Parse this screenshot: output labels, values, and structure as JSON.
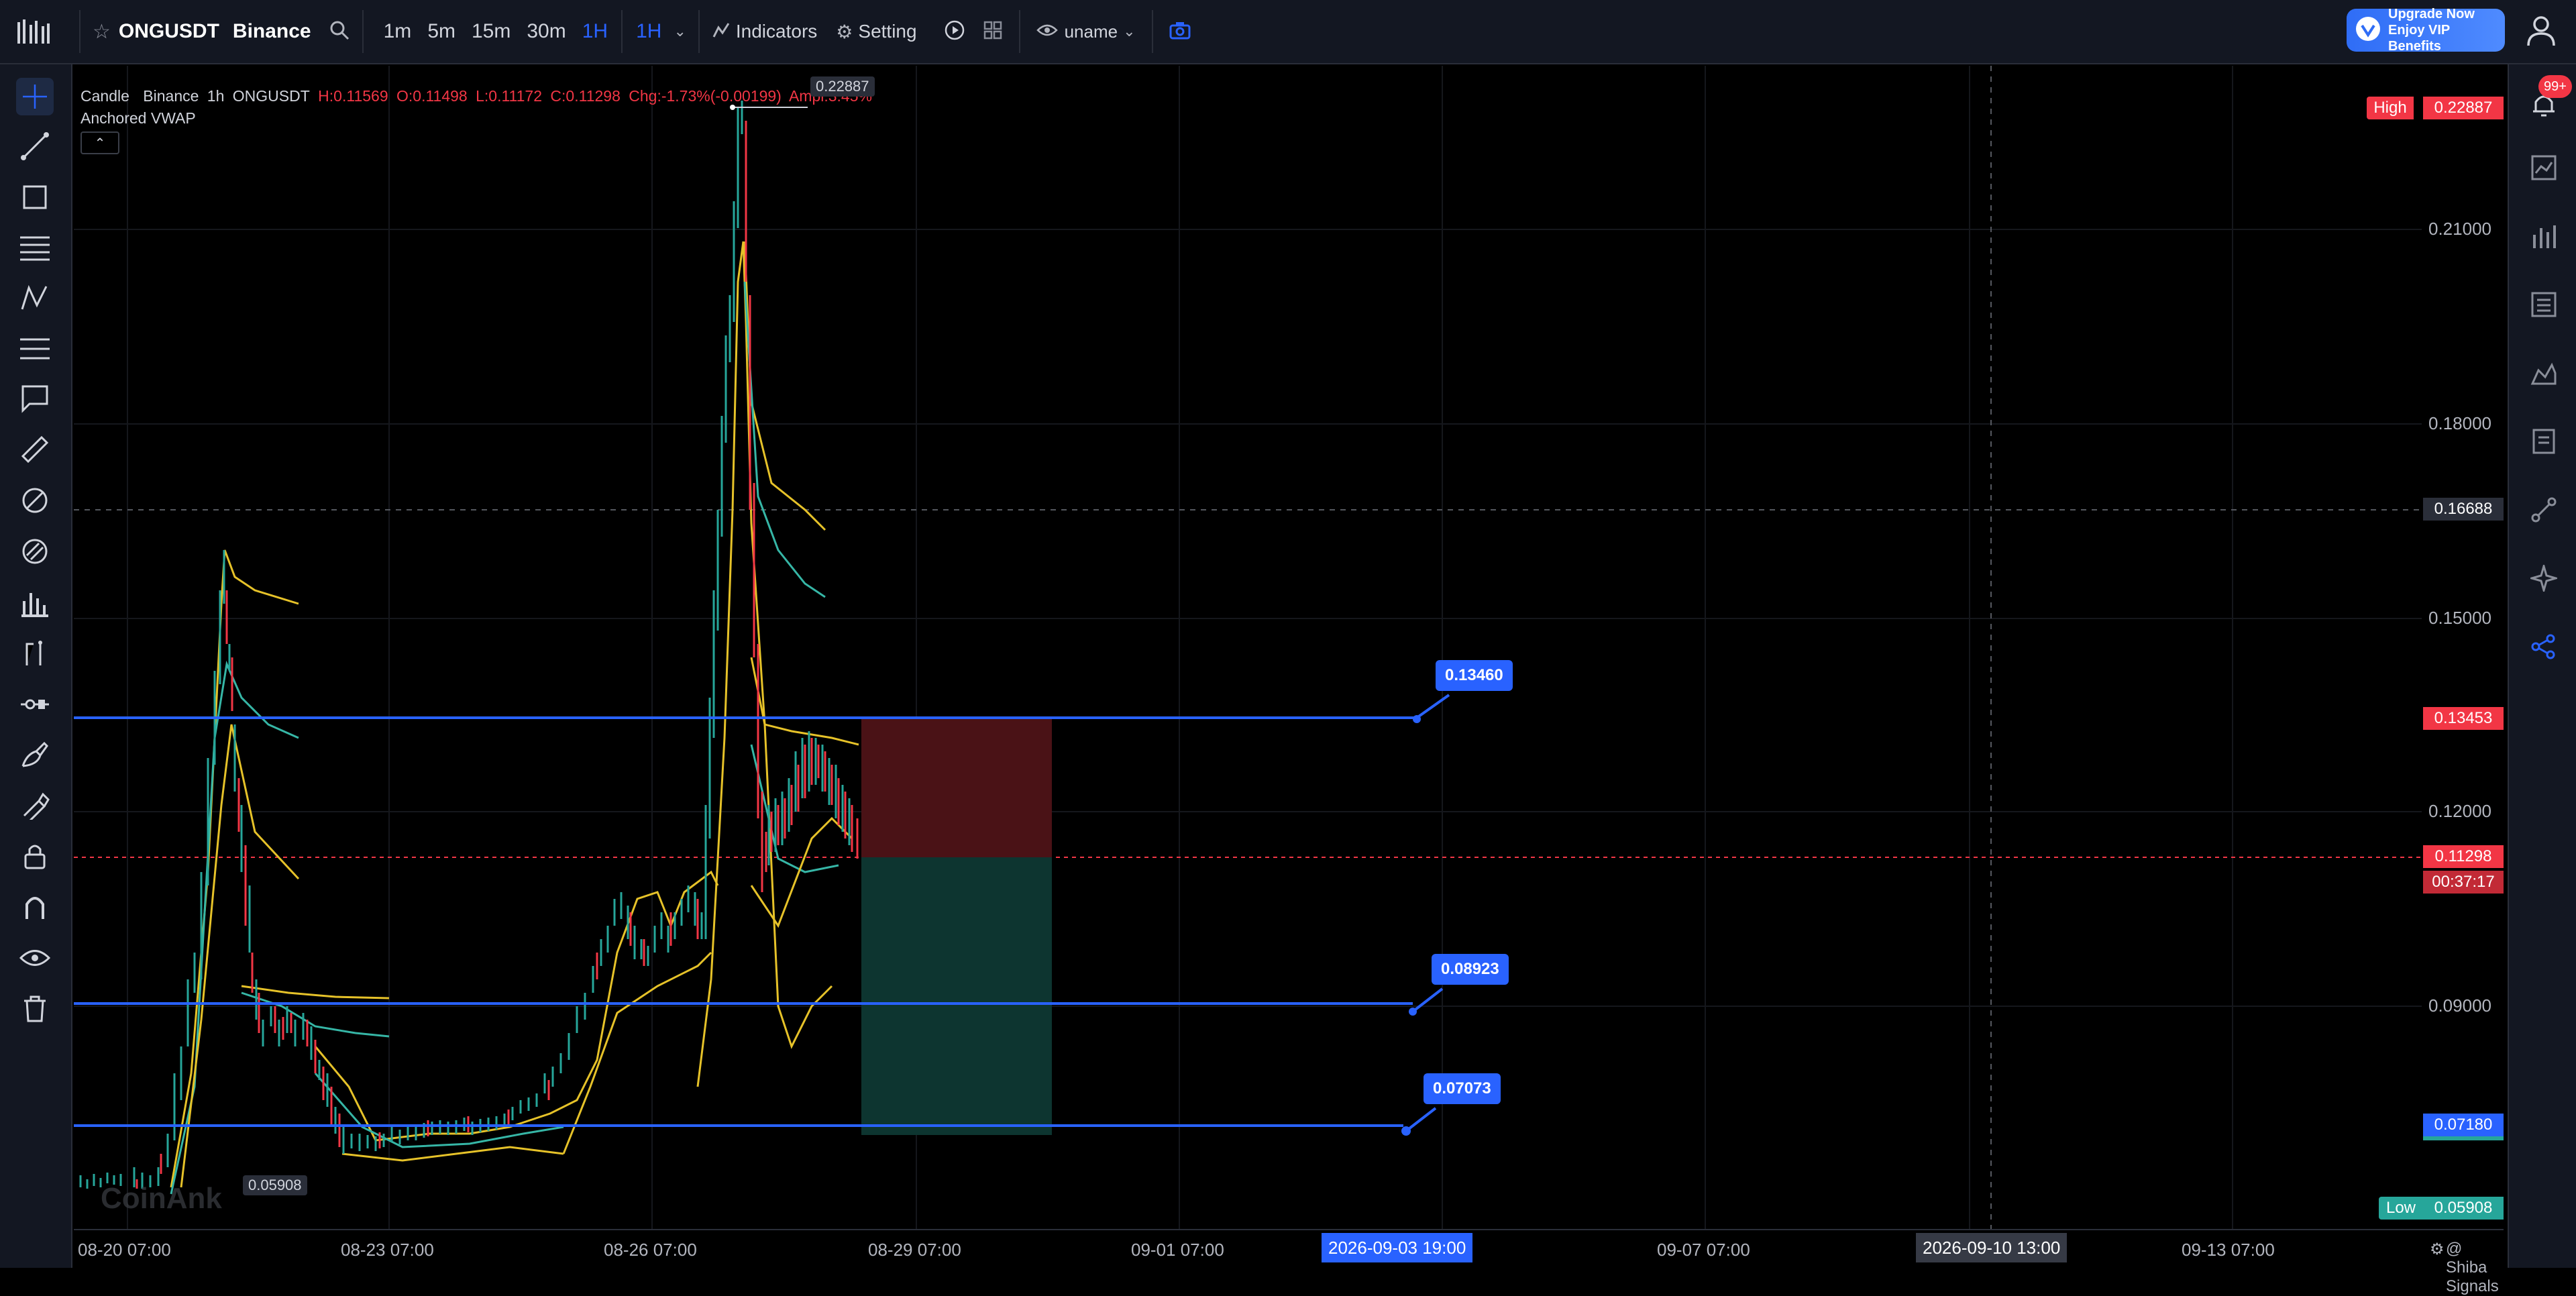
{
  "topbar": {
    "symbol": "ONGUSDT",
    "exchange": "Binance",
    "timeframes": [
      "1m",
      "5m",
      "15m",
      "30m",
      "1H"
    ],
    "active_interval": "1H",
    "indicators_label": "Indicators",
    "setting_label": "Setting",
    "username": "uname",
    "upgrade_line1": "Upgrade Now",
    "upgrade_line2": "Enjoy VIP Benefits"
  },
  "legend": {
    "type": "Candle",
    "exchange": "Binance",
    "interval": "1h",
    "symbol": "ONGUSDT",
    "h": "H:0.11569",
    "o": "O:0.11498",
    "l": "L:0.11172",
    "c": "C:0.11298",
    "chg": "Chg:-1.73%(-0.00199)",
    "ampl": "Ampl:3.45%",
    "indicator": "Anchored VWAP"
  },
  "price_axis": {
    "ticks": [
      "0.21000",
      "0.18000",
      "0.15000",
      "0.12000",
      "0.09000"
    ],
    "high_label": "High",
    "high_value": "0.22887",
    "crosshair_price": "0.16688",
    "line_price": "0.13453",
    "last_price": "0.11298",
    "countdown": "00:37:17",
    "bottom_line_price": "0.07180",
    "low_label": "Low",
    "low_value": "0.05908"
  },
  "time_axis": {
    "ticks": [
      "08-20 07:00",
      "08-23 07:00",
      "08-26 07:00",
      "08-29 07:00",
      "09-01 07:00",
      "09-07 07:00",
      "09-13 07:00"
    ],
    "highlight_1": "2026-09-03 19:00",
    "highlight_2": "2026-09-10 13:00",
    "footer": "@ Shiba Signals"
  },
  "chart_annotations": {
    "line_label_top": "0.13460",
    "line_label_mid": "0.08923",
    "line_label_low": "0.07073",
    "peak_label": "0.22887",
    "min_label": "0.05908",
    "watermark": "CoinAnk"
  },
  "notifications": {
    "badge": "99+"
  },
  "colors": {
    "accent": "#2962ff",
    "bull": "#26a69a",
    "bear": "#f23645",
    "vwap": "#e6c229"
  }
}
